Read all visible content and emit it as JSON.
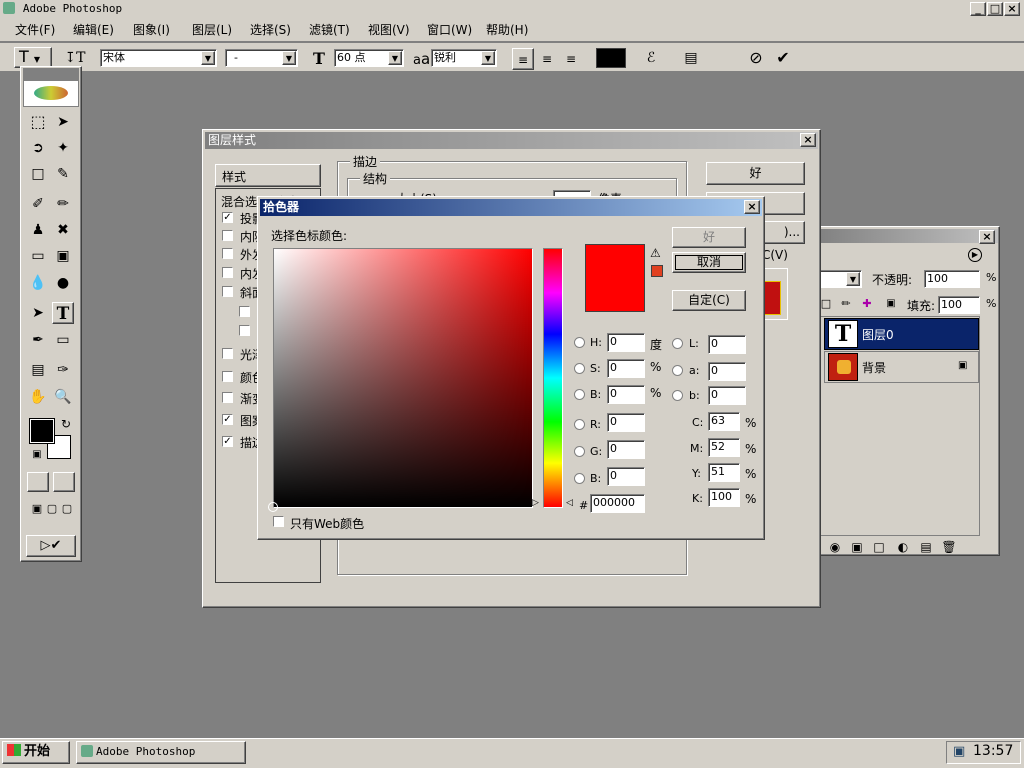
{
  "app": {
    "title": "Adobe Photoshop",
    "window_controls": [
      "_",
      "□",
      "×"
    ]
  },
  "menubar": [
    {
      "label": "文件(F)"
    },
    {
      "label": "编辑(E)"
    },
    {
      "label": "图象(I)"
    },
    {
      "label": "图层(L)"
    },
    {
      "label": "选择(S)"
    },
    {
      "label": "滤镜(T)"
    },
    {
      "label": "视图(V)"
    },
    {
      "label": "窗口(W)"
    },
    {
      "label": "帮助(H)"
    }
  ],
  "options_bar": {
    "tool_glyph": "T",
    "font_family": "宋体",
    "font_style": "-",
    "font_size": "60 点",
    "aa_glyph": "a",
    "antialias": "锐利",
    "text_color": "#000000"
  },
  "layer_style_dialog": {
    "title": "图层样式",
    "close": "×",
    "styles_header": "样式",
    "blend_options": "混合选项:默认",
    "style_rows": [
      {
        "label": "投影",
        "checked": "✓"
      },
      {
        "label": "内阴影",
        "checked": ""
      },
      {
        "label": "外发光",
        "checked": ""
      },
      {
        "label": "内发光",
        "checked": ""
      },
      {
        "label": "斜面和浮雕",
        "checked": ""
      },
      {
        "label": "",
        "checked": ""
      },
      {
        "label": "",
        "checked": ""
      },
      {
        "label": "光泽",
        "checked": ""
      },
      {
        "label": "颜色叠加",
        "checked": ""
      },
      {
        "label": "渐变叠加",
        "checked": ""
      },
      {
        "label": "图案叠加",
        "checked": "✓"
      },
      {
        "label": "描边",
        "checked": "✓"
      }
    ],
    "group_stroke": "描边",
    "group_structure": "结构",
    "size_label": "大小(S):",
    "size_unit": "像素",
    "ok": "好",
    "preview_label": "预览(V)"
  },
  "color_picker": {
    "title": "拾色器",
    "close": "×",
    "subtitle": "选择色标颜色:",
    "ok": "好",
    "cancel": "取消",
    "custom": "自定(C)",
    "warning_glyph": "⚠",
    "current_color": "#ff0000",
    "gamut_color": "#e04020",
    "web_only_label": "只有Web颜色",
    "hsb": [
      {
        "label": "H:",
        "value": "0",
        "unit": "度"
      },
      {
        "label": "S:",
        "value": "0",
        "unit": "%"
      },
      {
        "label": "B:",
        "value": "0",
        "unit": "%"
      }
    ],
    "rgb": [
      {
        "label": "R:",
        "value": "0"
      },
      {
        "label": "G:",
        "value": "0"
      },
      {
        "label": "B:",
        "value": "0"
      }
    ],
    "lab": [
      {
        "label": "L:",
        "value": "0"
      },
      {
        "label": "a:",
        "value": "0"
      },
      {
        "label": "b:",
        "value": "0"
      }
    ],
    "cmyk": [
      {
        "label": "C:",
        "value": "63",
        "unit": "%"
      },
      {
        "label": "M:",
        "value": "52",
        "unit": "%"
      },
      {
        "label": "Y:",
        "value": "51",
        "unit": "%"
      },
      {
        "label": "K:",
        "value": "100",
        "unit": "%"
      }
    ],
    "hex_label": "#",
    "hex_value": "000000"
  },
  "layers_panel": {
    "opacity_label": "不透明:",
    "opacity_value": "100",
    "fill_label": "填充:",
    "fill_value": "100",
    "percent": "%",
    "layers": [
      {
        "name": "图层0",
        "thumb": "T",
        "selected": true
      },
      {
        "name": "背景",
        "thumb": "",
        "selected": false
      }
    ],
    "lock_glyph": "🔒"
  },
  "taskbar": {
    "start_label": "开始",
    "task_label": "Adobe Photoshop",
    "clock": "13:57"
  }
}
